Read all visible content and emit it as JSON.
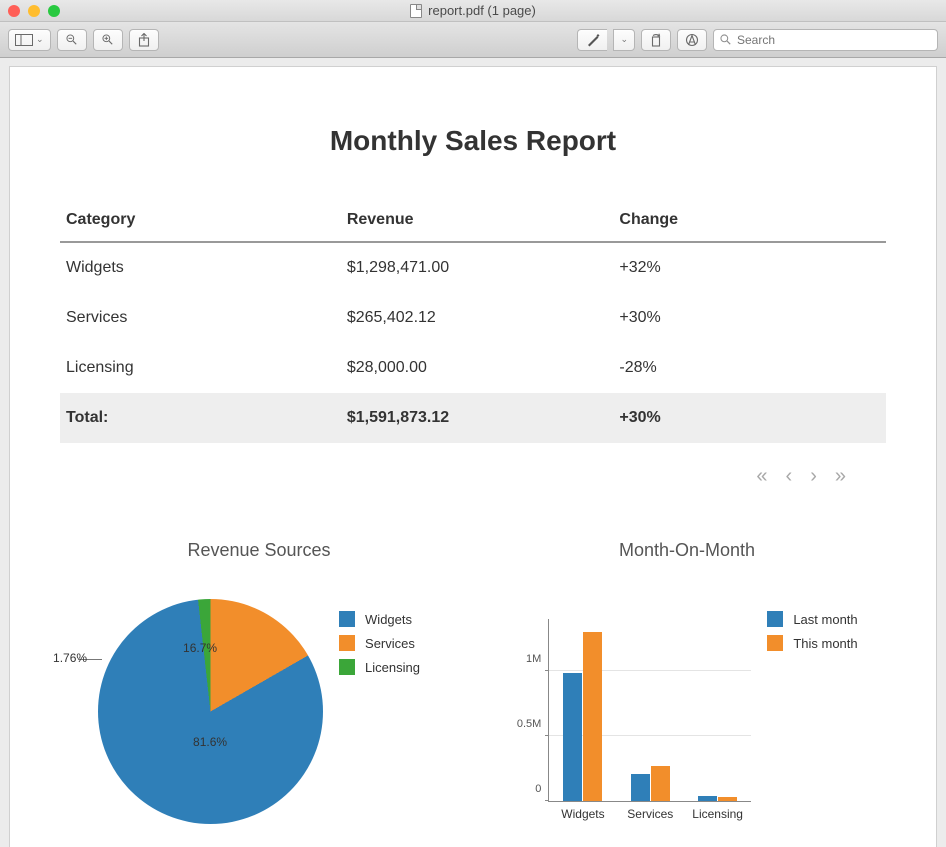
{
  "window": {
    "title": "report.pdf (1 page)"
  },
  "toolbar": {
    "search_placeholder": "Search"
  },
  "document": {
    "title": "Monthly Sales Report",
    "table": {
      "headers": [
        "Category",
        "Revenue",
        "Change"
      ],
      "rows": [
        {
          "category": "Widgets",
          "revenue": "$1,298,471.00",
          "change": "+32%"
        },
        {
          "category": "Services",
          "revenue": "$265,402.12",
          "change": "+30%"
        },
        {
          "category": "Licensing",
          "revenue": "$28,000.00",
          "change": "-28%"
        }
      ],
      "total": {
        "label": "Total:",
        "revenue": "$1,591,873.12",
        "change": "+30%"
      }
    },
    "charts": {
      "pie": {
        "title": "Revenue Sources",
        "labels": {
          "widgets": "81.6%",
          "services": "16.7%",
          "licensing": "1.76%"
        },
        "legend": [
          "Widgets",
          "Services",
          "Licensing"
        ]
      },
      "bar": {
        "title": "Month-On-Month",
        "y_labels": {
          "zero": "0",
          "half": "0.5M",
          "one": "1M"
        },
        "categories": [
          "Widgets",
          "Services",
          "Licensing"
        ],
        "legend": [
          "Last month",
          "This month"
        ]
      }
    }
  },
  "chart_data": [
    {
      "type": "pie",
      "title": "Revenue Sources",
      "series": [
        {
          "name": "Widgets",
          "value": 81.6
        },
        {
          "name": "Services",
          "value": 16.7
        },
        {
          "name": "Licensing",
          "value": 1.76
        }
      ]
    },
    {
      "type": "bar",
      "title": "Month-On-Month",
      "categories": [
        "Widgets",
        "Services",
        "Licensing"
      ],
      "series": [
        {
          "name": "Last month",
          "values": [
            983690,
            204156,
            38889
          ]
        },
        {
          "name": "This month",
          "values": [
            1298471,
            265402,
            28000
          ]
        }
      ],
      "ylabel": "",
      "ylim": [
        0,
        1400000
      ],
      "y_ticks": [
        0,
        500000,
        1000000
      ]
    }
  ]
}
